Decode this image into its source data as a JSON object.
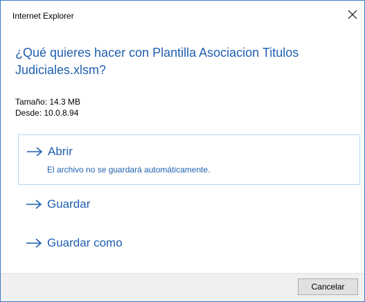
{
  "window": {
    "title": "Internet Explorer",
    "close_icon": "close-icon"
  },
  "prompt": {
    "question": "¿Qué quieres hacer con Plantilla Asociacion Titulos Judiciales.xlsm?"
  },
  "file_info": {
    "size": "Tamaño: 14.3 MB",
    "source": "Desde: 10.0.8.94"
  },
  "options": [
    {
      "label": "Abrir",
      "subtext": "El archivo no se guardará automáticamente.",
      "icon": "arrow-right-icon",
      "selected": true
    },
    {
      "label": "Guardar",
      "icon": "arrow-right-icon",
      "selected": false
    },
    {
      "label": "Guardar como",
      "icon": "arrow-right-icon",
      "selected": false
    }
  ],
  "footer": {
    "cancel_label": "Cancelar"
  },
  "colors": {
    "accent": "#1f5fb0",
    "window_border": "#3c78c8",
    "selection_border": "#b9d7ef",
    "footer_bg": "#f0f0f0"
  }
}
